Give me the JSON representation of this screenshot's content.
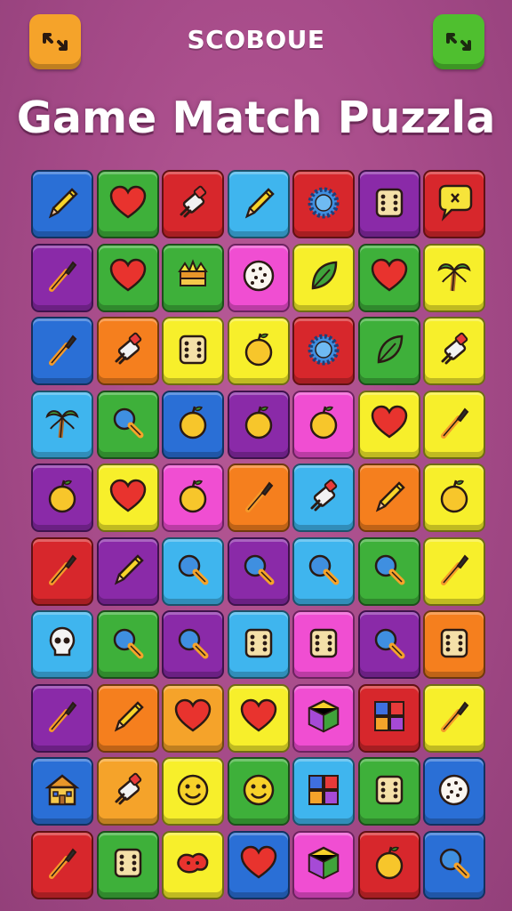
{
  "header": {
    "score_label": "SCOBOUE",
    "left_button_icon": "expand-arrows-icon",
    "right_button_icon": "expand-arrows-icon"
  },
  "title": "Game Match Puzzla",
  "colors": {
    "background": "#a54a88",
    "left_button": "#f5a32a",
    "right_button": "#4fbf2f"
  },
  "board": {
    "rows": [
      [
        {
          "c": "#2a6fd6",
          "i": "pencil"
        },
        {
          "c": "#3eb03a",
          "i": "heart"
        },
        {
          "c": "#d7272c",
          "i": "clipper"
        },
        {
          "c": "#3fb5ee",
          "i": "pencil"
        },
        {
          "c": "#d7272c",
          "i": "gear"
        },
        {
          "c": "#8a2aa8",
          "i": "dice"
        },
        {
          "c": "#d7272c",
          "i": "pin"
        }
      ],
      [
        {
          "c": "#8a2aa8",
          "i": "brush"
        },
        {
          "c": "#3eb03a",
          "i": "heart"
        },
        {
          "c": "#3eb03a",
          "i": "crown"
        },
        {
          "c": "#f04ed2",
          "i": "cookie"
        },
        {
          "c": "#f7ef2b",
          "i": "leaf"
        },
        {
          "c": "#3eb03a",
          "i": "heart"
        },
        {
          "c": "#f7ef2b",
          "i": "palm"
        }
      ],
      [
        {
          "c": "#2a6fd6",
          "i": "brush"
        },
        {
          "c": "#f57f1e",
          "i": "clipper"
        },
        {
          "c": "#f7ef2b",
          "i": "dice"
        },
        {
          "c": "#f7ef2b",
          "i": "apple"
        },
        {
          "c": "#d7272c",
          "i": "gear"
        },
        {
          "c": "#3eb03a",
          "i": "leaf"
        },
        {
          "c": "#f7ef2b",
          "i": "clipper"
        }
      ],
      [
        {
          "c": "#3fb5ee",
          "i": "palm"
        },
        {
          "c": "#3eb03a",
          "i": "magnifier"
        },
        {
          "c": "#2a6fd6",
          "i": "apple"
        },
        {
          "c": "#8a2aa8",
          "i": "apple"
        },
        {
          "c": "#f04ed2",
          "i": "apple"
        },
        {
          "c": "#f7ef2b",
          "i": "heart"
        },
        {
          "c": "#f7ef2b",
          "i": "brush"
        }
      ],
      [
        {
          "c": "#8a2aa8",
          "i": "apple"
        },
        {
          "c": "#f7ef2b",
          "i": "heart"
        },
        {
          "c": "#f04ed2",
          "i": "apple"
        },
        {
          "c": "#f57f1e",
          "i": "brush"
        },
        {
          "c": "#3fb5ee",
          "i": "clipper"
        },
        {
          "c": "#f57f1e",
          "i": "pencil"
        },
        {
          "c": "#f7ef2b",
          "i": "apple"
        }
      ],
      [
        {
          "c": "#d7272c",
          "i": "brush"
        },
        {
          "c": "#8a2aa8",
          "i": "pencil"
        },
        {
          "c": "#3fb5ee",
          "i": "magnifier"
        },
        {
          "c": "#8a2aa8",
          "i": "magnifier"
        },
        {
          "c": "#3fb5ee",
          "i": "magnifier"
        },
        {
          "c": "#3eb03a",
          "i": "magnifier"
        },
        {
          "c": "#f7ef2b",
          "i": "brush"
        }
      ],
      [
        {
          "c": "#3fb5ee",
          "i": "skull"
        },
        {
          "c": "#3eb03a",
          "i": "magnifier"
        },
        {
          "c": "#8a2aa8",
          "i": "magnifier"
        },
        {
          "c": "#3fb5ee",
          "i": "dice"
        },
        {
          "c": "#f04ed2",
          "i": "dice"
        },
        {
          "c": "#8a2aa8",
          "i": "magnifier"
        },
        {
          "c": "#f57f1e",
          "i": "dice"
        }
      ],
      [
        {
          "c": "#8a2aa8",
          "i": "brush"
        },
        {
          "c": "#f57f1e",
          "i": "pencil"
        },
        {
          "c": "#f5a32a",
          "i": "heart"
        },
        {
          "c": "#f7ef2b",
          "i": "heart"
        },
        {
          "c": "#f04ed2",
          "i": "cube"
        },
        {
          "c": "#d7272c",
          "i": "blocks"
        },
        {
          "c": "#f7ef2b",
          "i": "brush"
        }
      ],
      [
        {
          "c": "#2a6fd6",
          "i": "house"
        },
        {
          "c": "#f5a32a",
          "i": "clipper"
        },
        {
          "c": "#f7ef2b",
          "i": "smiley"
        },
        {
          "c": "#3eb03a",
          "i": "smiley"
        },
        {
          "c": "#3fb5ee",
          "i": "blocks"
        },
        {
          "c": "#3eb03a",
          "i": "dice"
        },
        {
          "c": "#2a6fd6",
          "i": "cookie"
        }
      ],
      [
        {
          "c": "#d7272c",
          "i": "brush"
        },
        {
          "c": "#3eb03a",
          "i": "dice"
        },
        {
          "c": "#f7ef2b",
          "i": "candy"
        },
        {
          "c": "#2a6fd6",
          "i": "heart"
        },
        {
          "c": "#f04ed2",
          "i": "cube"
        },
        {
          "c": "#d7272c",
          "i": "apple"
        },
        {
          "c": "#2a6fd6",
          "i": "magnifier"
        }
      ]
    ]
  }
}
